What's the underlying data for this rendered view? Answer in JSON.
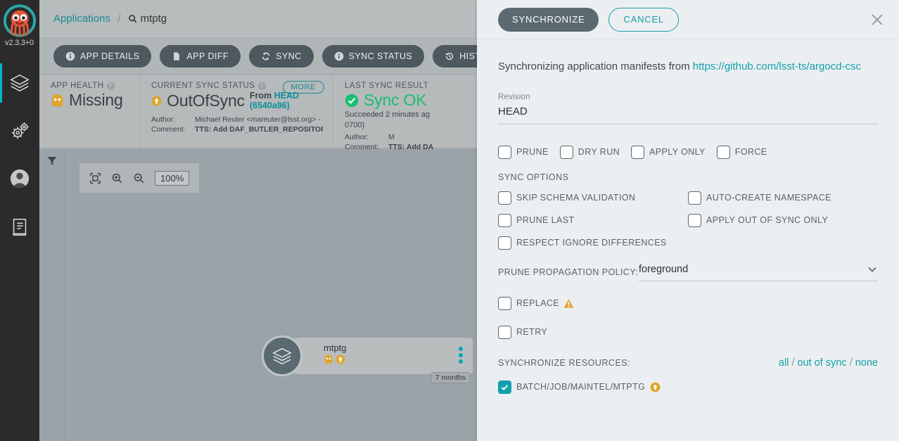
{
  "sidebar": {
    "version": "v2.3.3+0",
    "items": [
      {
        "name": "applications",
        "icon": "layers-icon"
      },
      {
        "name": "settings",
        "icon": "gears-icon"
      },
      {
        "name": "user-info",
        "icon": "user-icon"
      },
      {
        "name": "documentation",
        "icon": "book-icon"
      }
    ]
  },
  "breadcrumb": {
    "root": "Applications",
    "separator": "/",
    "current": "mtptg"
  },
  "toolbar": {
    "buttons": [
      {
        "label": "APP DETAILS",
        "icon": "info-icon"
      },
      {
        "label": "APP DIFF",
        "icon": "file-icon"
      },
      {
        "label": "SYNC",
        "icon": "sync-icon"
      },
      {
        "label": "SYNC STATUS",
        "icon": "info-icon"
      },
      {
        "label": "HISTORY AND ROLLE",
        "icon": "history-icon"
      }
    ]
  },
  "cards": {
    "health": {
      "label": "APP HEALTH",
      "value": "Missing",
      "icon": "ghost-icon"
    },
    "sync_status": {
      "label": "CURRENT SYNC STATUS",
      "value": "OutOfSync",
      "icon": "arrow-up-circle-icon",
      "more": "MORE",
      "from_prefix": "From ",
      "from_link": "HEAD (6540a96)",
      "author_key": "Author:",
      "author_value": "Michael Reuter <mareuter@lsst.org> -",
      "comment_key": "Comment:",
      "comment_value": "TTS: Add DAF_BUTLER_REPOSITORY_INDEX a..."
    },
    "last_sync": {
      "label": "LAST SYNC RESULT",
      "value": "Sync OK",
      "icon": "check-circle-icon",
      "sub_line1": "Succeeded 2 minutes ag",
      "sub_line2": "0700)",
      "author_key": "Author:",
      "author_value": "M",
      "comment_key": "Comment:",
      "comment_value": "TTS: Add DA"
    }
  },
  "graph": {
    "filter_icon": "funnel-icon",
    "zoom": {
      "fit_icon": "fit-screen-icon",
      "zoom_in_icon": "zoom-in-icon",
      "zoom_out_icon": "zoom-out-icon",
      "level": "100%"
    },
    "node": {
      "icon": "layers-icon",
      "title": "mtptg",
      "health_icon": "ghost-icon",
      "sync_icon": "arrow-up-circle-icon",
      "menu_icon": "kebab-menu-icon",
      "age": "7 months"
    }
  },
  "panel": {
    "synchronize_label": "SYNCHRONIZE",
    "cancel_label": "CANCEL",
    "close_icon": "close-icon",
    "description_prefix": "Synchronizing application manifests from ",
    "description_link": "https://github.com/lsst-ts/argocd-csc",
    "revision": {
      "label": "Revision",
      "value": "HEAD"
    },
    "main_options": [
      {
        "label": "PRUNE",
        "checked": false
      },
      {
        "label": "DRY RUN",
        "checked": false
      },
      {
        "label": "APPLY ONLY",
        "checked": false
      },
      {
        "label": "FORCE",
        "checked": false
      }
    ],
    "sync_options_title": "SYNC OPTIONS",
    "sync_options": [
      {
        "label": "SKIP SCHEMA VALIDATION",
        "checked": false
      },
      {
        "label": "AUTO-CREATE NAMESPACE",
        "checked": false
      },
      {
        "label": "PRUNE LAST",
        "checked": false
      },
      {
        "label": "APPLY OUT OF SYNC ONLY",
        "checked": false
      },
      {
        "label": "RESPECT IGNORE DIFFERENCES",
        "checked": false
      }
    ],
    "prune_policy": {
      "label": "PRUNE PROPAGATION POLICY:",
      "value": "foreground",
      "icon": "chevron-down-icon"
    },
    "replace": {
      "label": "REPLACE",
      "checked": false,
      "icon": "warning-icon"
    },
    "retry": {
      "label": "RETRY",
      "checked": false
    },
    "resources": {
      "title": "SYNCHRONIZE RESOURCES:",
      "link_all": "all",
      "link_out_of_sync": "out of sync",
      "link_none": "none",
      "sep": " / ",
      "items": [
        {
          "label": "BATCH/JOB/MAINTEL/MTPTG",
          "checked": true,
          "icon": "arrow-up-circle-icon"
        }
      ]
    }
  },
  "colors": {
    "accent_teal": "#12a0ad",
    "warning_amber": "#e8a33d",
    "success_green": "#18be71",
    "panel_bg": "#eceff1",
    "sidebar_bg": "#2b2b2b"
  }
}
